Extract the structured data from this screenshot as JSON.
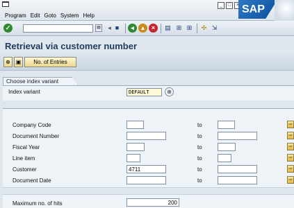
{
  "menu": {
    "items": [
      "Program",
      "Edit",
      "Goto",
      "System",
      "Help"
    ],
    "window_buttons": [
      "_",
      "□",
      "×"
    ],
    "logo": "SAP"
  },
  "toolbar": {
    "enter_icon": "check-icon",
    "command_value": "",
    "icons": [
      "back-icon",
      "save-icon",
      "back-arrow-icon",
      "exit-icon",
      "cancel-icon",
      "print-icon",
      "find-icon",
      "find-next-icon",
      "new-session-icon",
      "shortcut-icon"
    ]
  },
  "title": "Retrieval via customer number",
  "app_toolbar": {
    "execute_icon": "execute-icon",
    "variant_icon": "get-variant-icon",
    "entries_label": "No. of Entries"
  },
  "index_group": {
    "tab_label": "Choose index variant",
    "label": "Index variant",
    "value": "DEFAULT"
  },
  "selection": {
    "to_label": "to",
    "rows": [
      {
        "label": "Company Code",
        "from": "",
        "to": ""
      },
      {
        "label": "Document Number",
        "from": "",
        "to": ""
      },
      {
        "label": "Fiscal Year",
        "from": "",
        "to": ""
      },
      {
        "label": "Line item",
        "from": "",
        "to": ""
      },
      {
        "label": "Customer",
        "from": "4711",
        "to": ""
      },
      {
        "label": "Document Date",
        "from": "",
        "to": ""
      }
    ]
  },
  "max_hits": {
    "label": "Maximum no. of hits",
    "value": "200"
  },
  "colors": {
    "title": "#1e3d5c",
    "button_fill": "#e9d88f",
    "background": "#dfe6ee"
  }
}
